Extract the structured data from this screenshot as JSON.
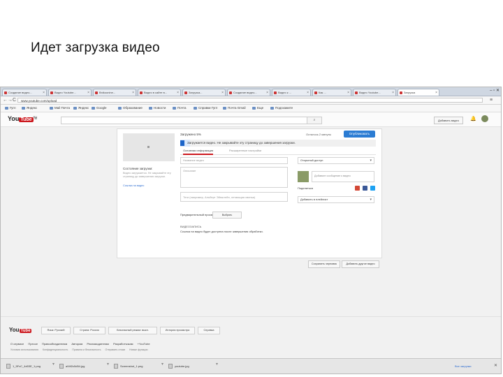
{
  "slide": {
    "title": "Идет загрузка видео"
  },
  "browser": {
    "tabs": [
      "Создание видео...",
      "Видео Youtube...",
      "Bnikoonine...",
      "Видео в сайте в...",
      "Загрузка...",
      "Создание видео...",
      "Видео к ...",
      "Как ...",
      "Видео Youtube...",
      "Загрузка"
    ],
    "window_buttons": "– ▫ ✕",
    "nav_glyphs": [
      "←",
      "→",
      "C"
    ],
    "url": "www.youtube.com/upload",
    "bookmarks": [
      "Гугл",
      "Яндекс",
      "Mail Почта",
      "Яндекс",
      "Google",
      "Образование",
      "Новости",
      "Почта",
      "Справки Гугл",
      "Почта Gmail",
      "Еще",
      "Подскажите"
    ]
  },
  "youtube": {
    "logo_text": "You",
    "logo_tube": "Tube",
    "logo_region": "RU",
    "search_glyph": "⌕",
    "upload_button": "Добавить видео",
    "bell": "🔔"
  },
  "upload": {
    "side_status": "Состояние загрузки:",
    "side_note": "Видео загружается. Не закрывайте эту страницу до завершения загрузки.",
    "side_link": "Ссылка на видео",
    "status_label": "Загружено 5%",
    "status_right": "Осталось 2 минуты",
    "done_button": "Опубликовать",
    "progress_percent": 5,
    "progress_text": "Загружается видео. Не закрывайте эту страницу до завершения загрузки.",
    "tabs": [
      "Основная информация",
      "Расширенные настройки"
    ],
    "title_placeholder": "Название видео",
    "description_placeholder": "Описание",
    "tags_placeholder": "Теги (например, Альберт Эйнштейн, летающая свинья)",
    "privacy_select": "Открытый доступ",
    "share_message": "Добавьте сообщение к видео",
    "share_label": "Поделиться",
    "playlist_select": "Добавить в плейлист",
    "preview_label": "Предварительный просмотр:",
    "preview_select": "Выбрать",
    "va_label": "ВИДЕОЗАПИСЬ",
    "va_link": "Ссылка на видео будет доступна после завершения обработки.",
    "save_draft": "Сохранить черновик",
    "add_video": "Добавить другое видео"
  },
  "footer": {
    "logo_text": "You",
    "logo_tube": "Tube",
    "lang": "Язык: Русский",
    "country": "Страна: Россия",
    "safety": "Безопасный режим: выкл.",
    "history": "История просмотра",
    "help": "Справка",
    "links": [
      "О сервисе",
      "Прессе",
      "Правообладателям",
      "Авторам",
      "Рекламодателям",
      "Разработчикам",
      "+YouTube"
    ],
    "links2": [
      "Условия использования",
      "Конфиденциальность",
      "Правила и безопасность",
      "Отправить отзыв",
      "Новые функции"
    ]
  },
  "downloads": {
    "items": [
      "1_5FvC_4d03E_1.png",
      "a94f2c5d54.jpg",
      "Screenshot_1.png",
      "youtube.jpg"
    ],
    "show_all": "Все загрузки",
    "close": "✕"
  },
  "colors": {
    "youtube_red": "#cc181e",
    "primary_blue": "#2b7cd3",
    "progress_bg": "#d9e7fb"
  }
}
